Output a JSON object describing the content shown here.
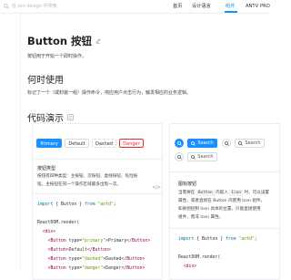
{
  "header": {
    "search_placeholder": "在 ant.design 中搜索",
    "nav": [
      "首页",
      "设计语言",
      "组件",
      "ANTV",
      "PRO"
    ],
    "active_nav": "组件",
    "accent_color": "#1890ff"
  },
  "page": {
    "title": "Button 按钮",
    "intro": "按钮用于开始一个即时操作。",
    "when_to_use_heading": "何时使用",
    "when_to_use_desc": "标记了一个（或封装一组）操作命令，响应用户点击行为，触发相应的业务逻辑。",
    "demos_heading": "代码演示"
  },
  "demo1": {
    "buttons": [
      "Primary",
      "Default",
      "Dashed",
      "Danger"
    ],
    "label": "按钮类型",
    "desc_lines": [
      "按钮有四种类型：主按钮、次按钮、虚线按钮、危险按",
      "钮。主按钮在同一个操作区域最多出现一次。"
    ],
    "code_toggle": "</>",
    "code": {
      "import_kw": "import",
      "import_body": " { Button } ",
      "from_kw": "from",
      "import_str": "\"antd\"",
      "render_line": "ReactDOM.render(",
      "div_open": "<div>",
      "btn_primary_type": "\"primary\"",
      "btn_primary_text": "Primary",
      "btn_default_text": "Default",
      "btn_dashed_type": "\"dashed\"",
      "btn_dashed_text": "Dashed",
      "btn_danger_type": "\"danger\"",
      "btn_danger_text": "Danger"
    }
  },
  "demo2": {
    "search_label": "Search",
    "label": "图标按钮",
    "desc_segments": [
      "当需要在 ",
      "Button",
      " 内嵌入 ",
      "Icon",
      " 时，可以设置"
    ],
    "desc_line2": "属性，或者直接在 Button 内使用 Icon 组件。",
    "desc_line3": "如果想控制 Icon 具体的位置，只能直接使用",
    "desc_line4": "组件，而非 Icon 属性。",
    "code": {
      "import_kw": "import",
      "import_body": " { Button } ",
      "from_kw": "from",
      "import_str": "\"antd\"",
      "render_line": "ReactDOM.render(",
      "div_open": "<div>"
    }
  }
}
